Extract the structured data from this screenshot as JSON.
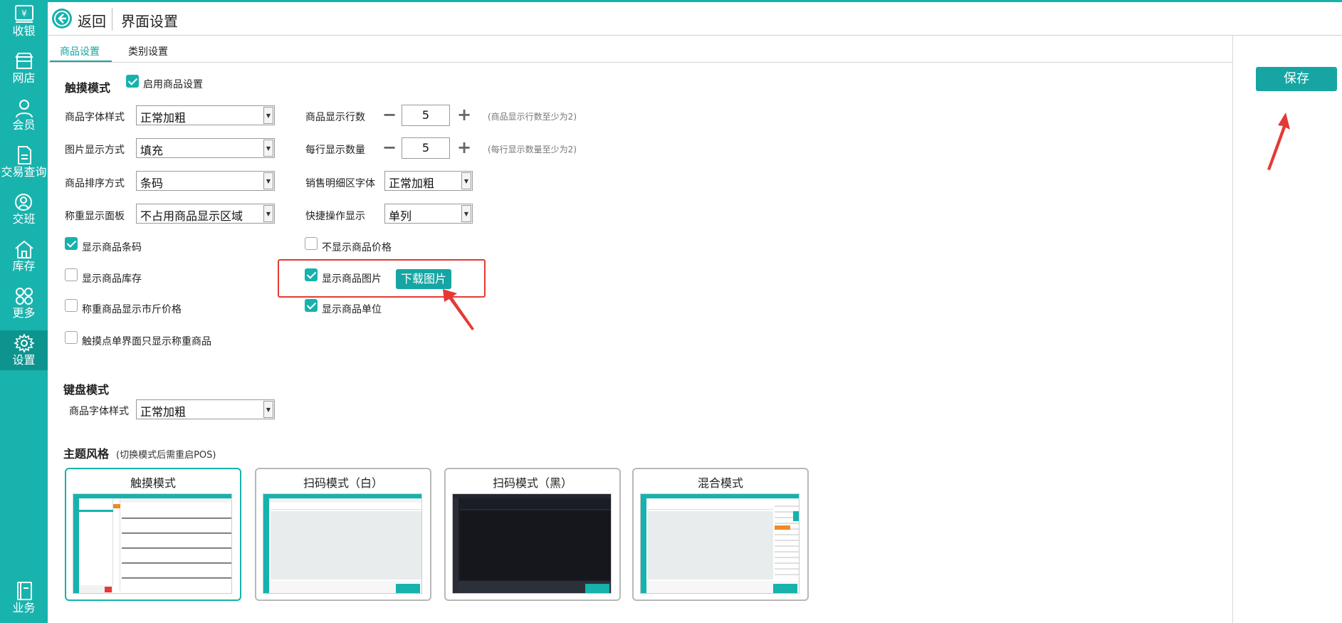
{
  "sidebar": {
    "items": [
      {
        "label": "收银",
        "icon": "cashier-yen-icon"
      },
      {
        "label": "网店",
        "icon": "store-icon"
      },
      {
        "label": "会员",
        "icon": "member-person-icon"
      },
      {
        "label": "交易查询",
        "icon": "document-icon"
      },
      {
        "label": "交班",
        "icon": "shift-handover-icon"
      },
      {
        "label": "库存",
        "icon": "warehouse-home-icon"
      },
      {
        "label": "更多",
        "icon": "grid-more-icon"
      },
      {
        "label": "设置",
        "icon": "gear-icon"
      },
      {
        "label": "业务",
        "icon": "book-icon"
      }
    ],
    "active": "设置"
  },
  "header": {
    "back_label": "返回",
    "title": "界面设置"
  },
  "tabs": [
    {
      "label": "商品设置"
    },
    {
      "label": "类别设置"
    }
  ],
  "save_label": "保存",
  "touch": {
    "title": "触摸模式",
    "enable_label": "启用商品设置",
    "font_style": {
      "label": "商品字体样式",
      "value": "正常加粗"
    },
    "image_display": {
      "label": "图片显示方式",
      "value": "填充"
    },
    "sort_mode": {
      "label": "商品排序方式",
      "value": "条码"
    },
    "weigh_panel": {
      "label": "称重显示面板",
      "value": "不占用商品显示区域"
    },
    "rows": {
      "label": "商品显示行数",
      "value": "5",
      "hint": "(商品显示行数至少为2)"
    },
    "per_row": {
      "label": "每行显示数量",
      "value": "5",
      "hint": "(每行显示数量至少为2)"
    },
    "detail_font": {
      "label": "销售明细区字体",
      "value": "正常加粗"
    },
    "quick_ops": {
      "label": "快捷操作显示",
      "value": "单列"
    },
    "checks": {
      "show_barcode": {
        "label": "显示商品条码",
        "checked": true
      },
      "hide_price": {
        "label": "不显示商品价格",
        "checked": false
      },
      "show_stock": {
        "label": "显示商品库存",
        "checked": false
      },
      "show_image": {
        "label": "显示商品图片",
        "checked": true
      },
      "weigh_jin": {
        "label": "称重商品显示市斤价格",
        "checked": false
      },
      "show_unit": {
        "label": "显示商品单位",
        "checked": true
      },
      "only_weigh": {
        "label": "触摸点单界面只显示称重商品",
        "checked": false
      }
    },
    "download_label": "下载图片"
  },
  "keyboard": {
    "title": "键盘模式",
    "font_style": {
      "label": "商品字体样式",
      "value": "正常加粗"
    }
  },
  "theme": {
    "title": "主题风格",
    "hint": "(切换模式后需重启POS)",
    "cards": [
      {
        "name": "触摸模式",
        "active": true
      },
      {
        "name": "扫码模式（白）",
        "active": false
      },
      {
        "name": "扫码模式（黑）",
        "active": false
      },
      {
        "name": "混合模式",
        "active": false
      }
    ]
  },
  "colors": {
    "accent": "#16b2ad",
    "accent_dark": "#0d948f",
    "annotation_red": "#e53935"
  }
}
